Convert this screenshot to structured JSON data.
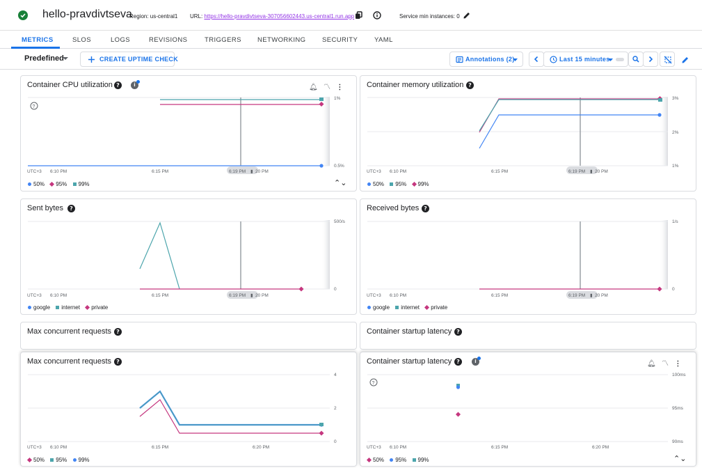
{
  "header": {
    "service_name": "hello-pravdivtseva",
    "region": "Region: us-central1",
    "url_label": "URL:",
    "url": "https://hello-pravdivtseva-307056602443.us-central1.run.app",
    "min_instances": "Service min instances: 0"
  },
  "tabs": [
    {
      "label": "METRICS",
      "active": true
    },
    {
      "label": "SLOS"
    },
    {
      "label": "LOGS"
    },
    {
      "label": "REVISIONS"
    },
    {
      "label": "TRIGGERS"
    },
    {
      "label": "NETWORKING"
    },
    {
      "label": "SECURITY"
    },
    {
      "label": "YAML"
    }
  ],
  "toolbar": {
    "predefined": "Predefined",
    "create_uptime": "CREATE UPTIME CHECK",
    "annotations": "Annotations (2)",
    "time_range": "Last 15 minutes"
  },
  "colors": {
    "blue": "#4285f4",
    "pink": "#c5377f",
    "teal": "#4ca5ac",
    "accent": "#1a73e8"
  },
  "panels": {
    "cpu": {
      "title": "Container CPU utilization",
      "y_ticks": [
        "1%",
        "0.5%"
      ],
      "x_ticks": [
        "UTC+3",
        "6:10 PM",
        "6:15 PM",
        "6:19 PM",
        "20 PM"
      ],
      "legend": [
        {
          "label": "50%",
          "shape": "dot",
          "color": "#4285f4"
        },
        {
          "label": "95%",
          "shape": "dia",
          "color": "#c5377f"
        },
        {
          "label": "99%",
          "shape": "sq",
          "color": "#4ca5ac"
        }
      ]
    },
    "memory": {
      "title": "Container memory utilization",
      "y_ticks": [
        "3%",
        "2%",
        "1%"
      ],
      "x_ticks": [
        "UTC+3",
        "6:10 PM",
        "6:15 PM",
        "6:19 PM",
        "20 PM"
      ],
      "legend": [
        {
          "label": "50%",
          "shape": "dot",
          "color": "#4285f4"
        },
        {
          "label": "95%",
          "shape": "sq",
          "color": "#4ca5ac"
        },
        {
          "label": "99%",
          "shape": "dia",
          "color": "#c5377f"
        }
      ]
    },
    "sent": {
      "title": "Sent bytes",
      "y_ticks": [
        "500/s",
        "0"
      ],
      "x_ticks": [
        "UTC+3",
        "6:10 PM",
        "6:15 PM",
        "6:19 PM",
        "20 PM"
      ],
      "legend": [
        {
          "label": "google",
          "shape": "dot",
          "color": "#4285f4"
        },
        {
          "label": "internet",
          "shape": "sq",
          "color": "#4ca5ac"
        },
        {
          "label": "private",
          "shape": "dia",
          "color": "#c5377f"
        }
      ]
    },
    "received": {
      "title": "Received bytes",
      "y_ticks": [
        "1/s",
        "0"
      ],
      "x_ticks": [
        "UTC+3",
        "6:10 PM",
        "6:15 PM",
        "6:19 PM",
        "20 PM"
      ],
      "legend": [
        {
          "label": "google",
          "shape": "dot",
          "color": "#4285f4"
        },
        {
          "label": "internet",
          "shape": "sq",
          "color": "#4ca5ac"
        },
        {
          "label": "private",
          "shape": "dia",
          "color": "#c5377f"
        }
      ]
    },
    "maxreq_bg": {
      "title": "Max concurrent requests"
    },
    "startup_bg": {
      "title": "Container startup latency"
    },
    "maxreq": {
      "title": "Max concurrent requests",
      "y_ticks": [
        "4",
        "2",
        "0"
      ],
      "x_ticks": [
        "UTC+3",
        "6:10 PM",
        "6:15 PM",
        "6:20 PM"
      ],
      "legend": [
        {
          "label": "50%",
          "shape": "dia",
          "color": "#c5377f"
        },
        {
          "label": "95%",
          "shape": "sq",
          "color": "#4ca5ac"
        },
        {
          "label": "99%",
          "shape": "dot",
          "color": "#4285f4"
        }
      ]
    },
    "startup": {
      "title": "Container startup latency",
      "y_ticks": [
        "100ms",
        "95ms",
        "90ms"
      ],
      "x_ticks": [
        "UTC+3",
        "6:10 PM",
        "6:15 PM",
        "6:20 PM"
      ],
      "legend": [
        {
          "label": "50%",
          "shape": "dia",
          "color": "#c5377f"
        },
        {
          "label": "95%",
          "shape": "dot",
          "color": "#4285f4"
        },
        {
          "label": "99%",
          "shape": "sq",
          "color": "#4ca5ac"
        }
      ]
    }
  },
  "chart_data": [
    {
      "type": "line",
      "title": "Container CPU utilization",
      "ylim": [
        0.5,
        1
      ],
      "series": [
        {
          "name": "50%",
          "values": [
            0.5,
            0.5
          ]
        },
        {
          "name": "95%",
          "values": [
            0.95,
            0.95
          ]
        },
        {
          "name": "99%",
          "values": [
            1,
            1
          ]
        }
      ]
    },
    {
      "type": "line",
      "title": "Container memory utilization",
      "ylim": [
        1,
        3
      ],
      "series": [
        {
          "name": "50%",
          "values": [
            1.5,
            2.5,
            2.5
          ]
        },
        {
          "name": "95%",
          "values": [
            2,
            2.95,
            2.95
          ]
        },
        {
          "name": "99%",
          "values": [
            2,
            3,
            3
          ]
        }
      ]
    },
    {
      "type": "line",
      "title": "Sent bytes",
      "ylim": [
        0,
        500
      ],
      "series": [
        {
          "name": "internet",
          "values": [
            150,
            500,
            0
          ]
        },
        {
          "name": "private",
          "values": [
            0,
            0
          ]
        }
      ]
    },
    {
      "type": "line",
      "title": "Received bytes",
      "ylim": [
        0,
        1
      ],
      "series": [
        {
          "name": "private",
          "values": [
            0,
            0
          ]
        }
      ]
    },
    {
      "type": "line",
      "title": "Max concurrent requests",
      "ylim": [
        0,
        4
      ],
      "series": [
        {
          "name": "50%",
          "values": [
            1.5,
            2.5,
            0.5,
            0.5
          ]
        },
        {
          "name": "95%",
          "values": [
            2,
            3,
            1,
            1
          ]
        },
        {
          "name": "99%",
          "values": [
            2,
            3,
            1,
            1
          ]
        }
      ]
    },
    {
      "type": "scatter",
      "title": "Container startup latency",
      "ylim": [
        90,
        100
      ],
      "series": [
        {
          "name": "50%",
          "values": [
            94
          ]
        },
        {
          "name": "95%",
          "values": [
            98
          ]
        },
        {
          "name": "99%",
          "values": [
            98.5
          ]
        }
      ]
    }
  ]
}
